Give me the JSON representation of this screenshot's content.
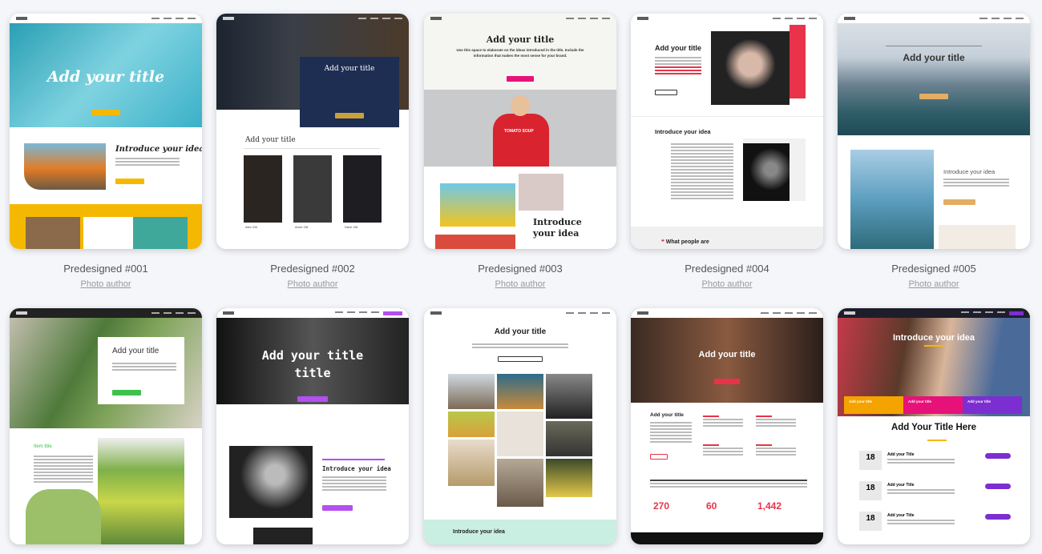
{
  "templates": [
    {
      "name": "Predesigned #001",
      "author": "Photo author",
      "hero": "Add your title",
      "section": "Introduce your idea"
    },
    {
      "name": "Predesigned #002",
      "author": "Photo author",
      "hero": "Add your title",
      "section": "Add your title",
      "people": [
        "Alex Gill",
        "Anne Gill",
        "Dave Gill"
      ]
    },
    {
      "name": "Predesigned #003",
      "author": "Photo author",
      "hero": "Add your title",
      "sub": "Use this space to elaborate on the ideas introduced in the title. Include the information that makes the most sense for your brand.",
      "shirt": "TOMATO SOUP",
      "section": "Introduce your idea"
    },
    {
      "name": "Predesigned #004",
      "author": "Photo author",
      "hero": "Add your title",
      "section": "Introduce your idea",
      "footer": "What people are"
    },
    {
      "name": "Predesigned #005",
      "author": "Photo author",
      "hero": "Add your title",
      "section": "Introduce your idea"
    },
    {
      "hero": "Add your title",
      "section": "Item title"
    },
    {
      "hero": "Add your title",
      "hero2": "title",
      "section": "Introduce your idea"
    },
    {
      "hero": "Add your title",
      "section": "Introduce your idea"
    },
    {
      "hero": "Add your title",
      "section": "Add your title",
      "stats": [
        "270",
        "60",
        "1,442"
      ]
    },
    {
      "hero": "Introduce your idea",
      "tiles": [
        "Add your title",
        "Add your title",
        "Add your title"
      ],
      "section": "Add Your Title Here",
      "events": [
        {
          "day": "18",
          "title": "Add your Title"
        },
        {
          "day": "18",
          "title": "Add your Title"
        },
        {
          "day": "18",
          "title": "Add your Title"
        }
      ]
    }
  ],
  "colors": {
    "accent_yellow": "#f5b800",
    "pink": "#e6127a",
    "purple": "#7b2fd1",
    "red": "#e8334a"
  }
}
